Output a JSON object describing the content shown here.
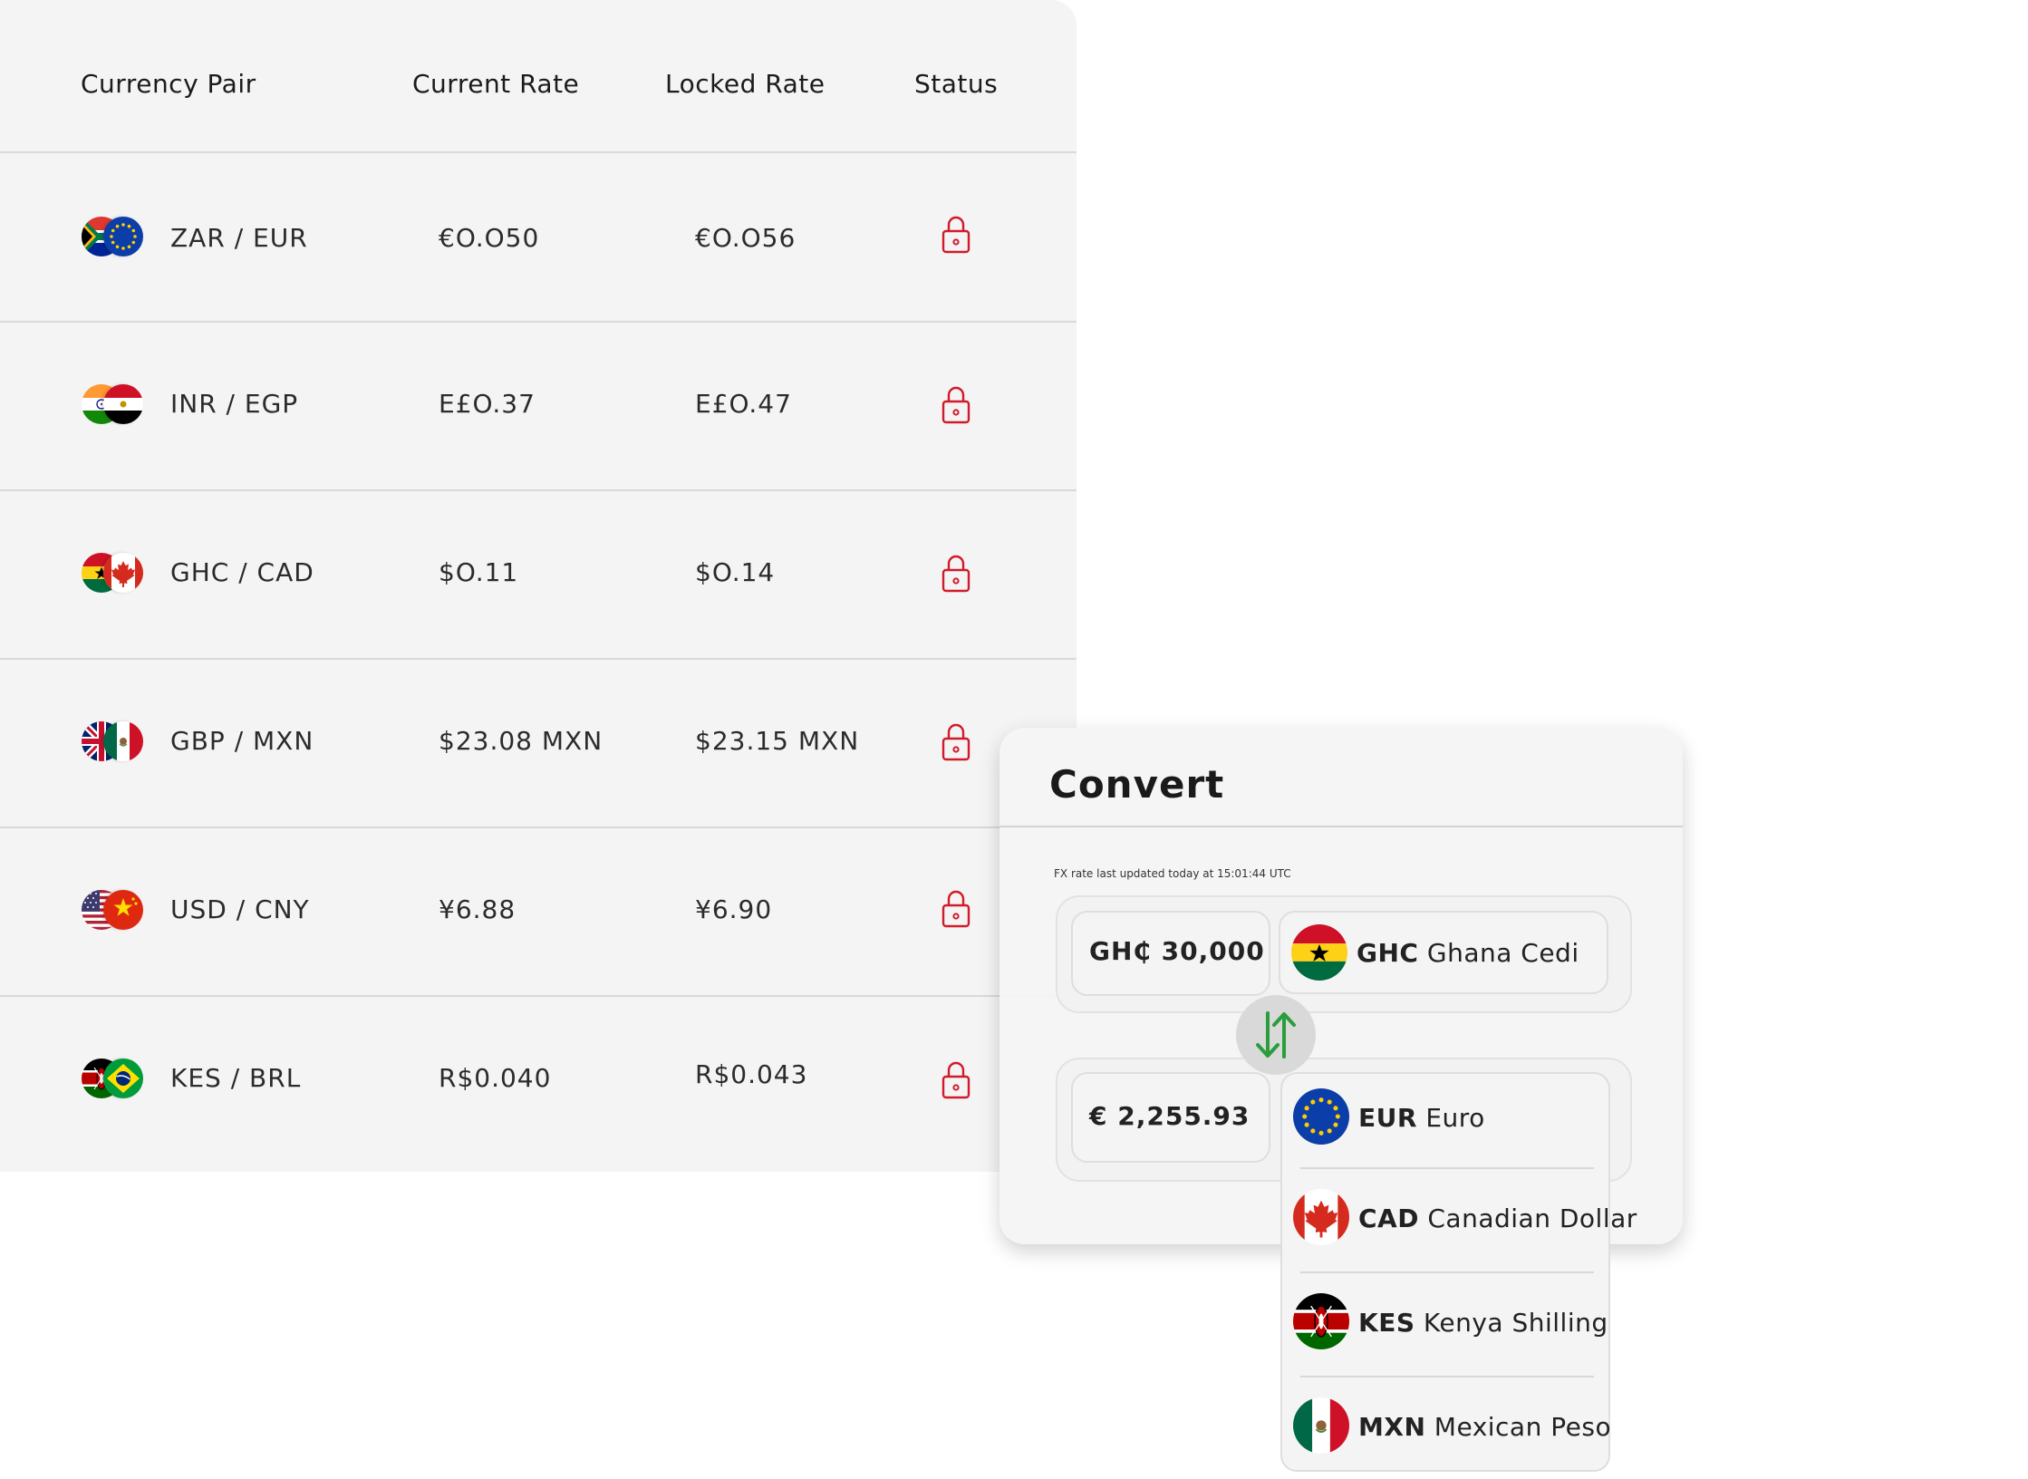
{
  "rates_table": {
    "headers": {
      "pair": "Currency Pair",
      "current": "Current Rate",
      "locked": "Locked Rate",
      "status": "Status"
    },
    "rows": [
      {
        "pair": "ZAR / EUR",
        "current": "€O.O50",
        "locked": "€O.O56",
        "flag_left": "za-flag-icon",
        "flag_right": "eu-flag-icon",
        "status": "locked"
      },
      {
        "pair": "INR / EGP",
        "current": "E£O.37",
        "locked": "E£O.47",
        "flag_left": "in-flag-icon",
        "flag_right": "eg-flag-icon",
        "status": "locked"
      },
      {
        "pair": "GHC / CAD",
        "current": "$O.11",
        "locked": "$O.14",
        "flag_left": "gh-flag-icon",
        "flag_right": "ca-flag-icon",
        "status": "locked"
      },
      {
        "pair": "GBP / MXN",
        "current": "$23.08 MXN",
        "locked": "$23.15 MXN",
        "flag_left": "gb-flag-icon",
        "flag_right": "mx-flag-icon",
        "status": "locked"
      },
      {
        "pair": "USD / CNY",
        "current": "¥6.88",
        "locked": "¥6.90",
        "flag_left": "us-flag-icon",
        "flag_right": "cn-flag-icon",
        "status": "locked"
      },
      {
        "pair": "KES / BRL",
        "current": "R$0.040",
        "locked": "R$0.043",
        "flag_left": "ke-flag-icon",
        "flag_right": "br-flag-icon",
        "status": "locked"
      }
    ],
    "status_icon": "lock-icon"
  },
  "convert": {
    "title": "Convert",
    "fx_note": "FX rate last updated today at 15:01:44 UTC",
    "from": {
      "amount": "GH₵ 30,000",
      "code": "GHC",
      "name": "Ghana Cedi",
      "flag": "gh-flag-icon"
    },
    "to": {
      "amount": "€ 2,255.93",
      "code": "EUR",
      "name": "Euro",
      "flag": "eu-flag-icon"
    },
    "swap_icon": "swap-arrows-icon",
    "dropdown_options": [
      {
        "code": "CAD",
        "name": "Canadian Dollar",
        "flag": "ca-flag-icon"
      },
      {
        "code": "KES",
        "name": "Kenya Shilling",
        "flag": "ke-flag-icon"
      },
      {
        "code": "MXN",
        "name": "Mexican Peso",
        "flag": "mx-flag-icon"
      }
    ]
  },
  "colors": {
    "lock_red": "#d11a2a",
    "swap_green": "#2a9d3c",
    "card_bg": "#f4f4f4",
    "divider": "#d9d9d9"
  }
}
